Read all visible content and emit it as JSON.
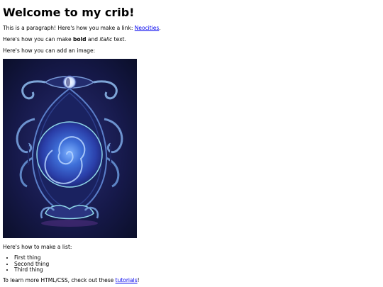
{
  "heading": "Welcome to my crib!",
  "para_link": {
    "prefix": "This is a paragraph! Here's how you make a link: ",
    "link_text": "Neocities",
    "suffix": "."
  },
  "para_format": {
    "prefix": "Here's how you can make ",
    "bold": "bold",
    "middle": " and ",
    "italic": "italic",
    "suffix": " text."
  },
  "para_image": "Here's how you can add an image:",
  "para_list": "Here's how to make a list:",
  "list_items": [
    "First thing",
    "Second thing",
    "Third thing"
  ],
  "para_tutorials": {
    "prefix": "To learn more HTML/CSS, check out these ",
    "link_text": "tutorials",
    "suffix": "!"
  },
  "colors": {
    "link": "#0000ee",
    "art_background": "#101a3c",
    "art_orb": "#3a6fd8"
  }
}
